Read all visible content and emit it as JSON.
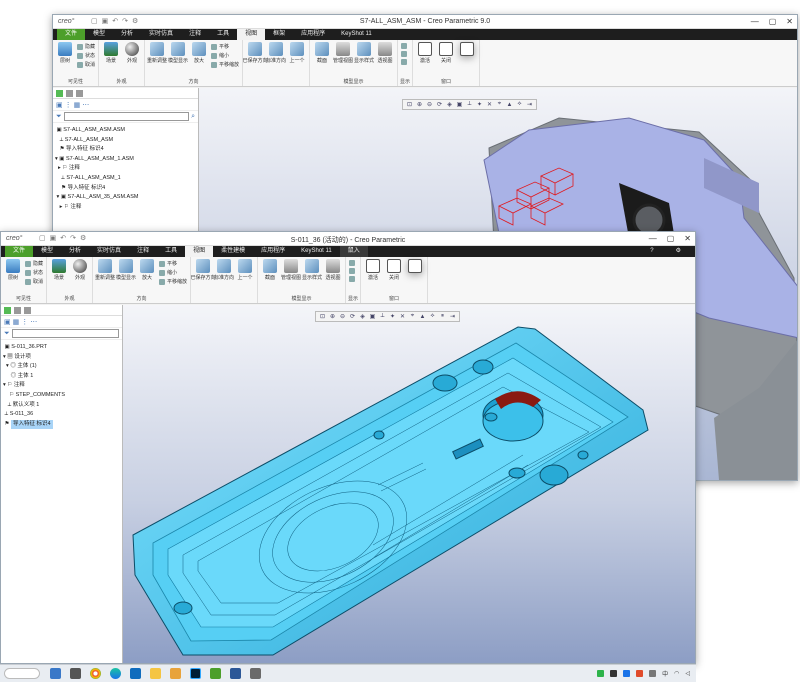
{
  "back_window": {
    "logo": "creo°",
    "title": "S7-ALL_ASM_ASM - Creo Parametric 9.0",
    "menu": [
      "文件",
      "模型",
      "分析",
      "实时仿真",
      "注释",
      "工具",
      "视图",
      "框架",
      "应用程序",
      "KeyShot 11"
    ],
    "active_menu": "视图",
    "ribbon_groups": [
      {
        "label": "可见性",
        "big": [
          {
            "label": "层树",
            "icon": "layer-icon"
          }
        ],
        "small": [
          "隐藏",
          "状态",
          "取消"
        ]
      },
      {
        "label": "外观",
        "big": [
          {
            "label": "场景",
            "icon": "scene-icon"
          },
          {
            "label": "外观",
            "icon": "appearance-icon"
          }
        ],
        "small": []
      },
      {
        "label": "方向",
        "big": [
          {
            "label": "重新调整",
            "icon": "refit-icon"
          },
          {
            "label": "模型显示",
            "icon": "model-display-icon"
          },
          {
            "label": "放大",
            "icon": "zoom-in-icon"
          }
        ],
        "small": [
          "平移",
          "缩小",
          "平移缩放"
        ]
      },
      {
        "label": "",
        "big": [
          {
            "label": "已保存方向",
            "icon": "saved-orientation-icon"
          },
          {
            "label": "标准方向",
            "icon": "standard-orientation-icon"
          },
          {
            "label": "上一个",
            "icon": "previous-icon"
          }
        ],
        "small": []
      },
      {
        "label": "模型显示",
        "big": [
          {
            "label": "截面",
            "icon": "section-icon"
          },
          {
            "label": "管理视图",
            "icon": "manage-views-icon"
          },
          {
            "label": "显示样式",
            "icon": "display-style-icon"
          },
          {
            "label": "透视图",
            "icon": "perspective-icon"
          }
        ],
        "small": []
      },
      {
        "label": "显示",
        "big": [],
        "small": [
          "",
          "",
          ""
        ]
      },
      {
        "label": "窗口",
        "big": [
          {
            "label": "激活",
            "icon": "activate-icon"
          },
          {
            "label": "关闭",
            "icon": "close-window-icon"
          },
          {
            "label": "窗口",
            "icon": "windows-icon"
          }
        ],
        "small": []
      }
    ],
    "tree": [
      "S7-ALL_ASM_ASM.ASM",
      "S7-ALL_ASM_ASM",
      "导入特征 标识4",
      "S7-ALL_ASM_ASM_1.ASM",
      "注释",
      "S7-ALL_ASM_ASM_1",
      "导入特征 标识4",
      "S7-ALL_ASM_35_ASM.ASM",
      "注释"
    ]
  },
  "front_window": {
    "logo": "creo°",
    "title": "S-011_36 (活动的) - Creo Parametric",
    "menu": [
      "文件",
      "模型",
      "分析",
      "实时仿真",
      "注释",
      "工具",
      "视图",
      "柔性建模",
      "应用程序",
      "KeyShot 11",
      "鼠入"
    ],
    "active_menu": "视图",
    "ribbon_groups": [
      {
        "label": "可见性",
        "big": [
          {
            "label": "层树",
            "icon": "layer-icon"
          }
        ],
        "small": [
          "隐藏",
          "状态",
          "取消"
        ]
      },
      {
        "label": "外观",
        "big": [
          {
            "label": "场景",
            "icon": "scene-icon"
          },
          {
            "label": "外观",
            "icon": "appearance-icon"
          }
        ],
        "small": []
      },
      {
        "label": "方向",
        "big": [
          {
            "label": "重新调整",
            "icon": "refit-icon"
          },
          {
            "label": "模型显示",
            "icon": "model-display-icon"
          },
          {
            "label": "放大",
            "icon": "zoom-in-icon"
          }
        ],
        "small": [
          "平移",
          "缩小",
          "平移缩放"
        ]
      },
      {
        "label": "",
        "big": [
          {
            "label": "已保存方向",
            "icon": "saved-orientation-icon"
          },
          {
            "label": "标准方向",
            "icon": "standard-orientation-icon"
          },
          {
            "label": "上一个",
            "icon": "previous-icon"
          }
        ],
        "small": []
      },
      {
        "label": "模型显示",
        "big": [
          {
            "label": "截面",
            "icon": "section-icon"
          },
          {
            "label": "管理视图",
            "icon": "manage-views-icon"
          },
          {
            "label": "显示样式",
            "icon": "display-style-icon"
          },
          {
            "label": "透视图",
            "icon": "perspective-icon"
          }
        ],
        "small": []
      },
      {
        "label": "显示",
        "big": [],
        "small": [
          "",
          "",
          ""
        ]
      },
      {
        "label": "窗口",
        "big": [
          {
            "label": "激活",
            "icon": "activate-icon"
          },
          {
            "label": "关闭",
            "icon": "close-window-icon"
          },
          {
            "label": "窗口",
            "icon": "windows-icon"
          }
        ],
        "small": []
      }
    ],
    "tree": [
      "S-011_36.PRT",
      "设计项",
      "主体 (1)",
      "主体 1",
      "注释",
      "STEP_COMMENTS",
      "默认义项 1",
      "S-011_36",
      "导入特征 标识4"
    ],
    "selected_tree_item": "导入特征 标识4"
  },
  "colors": {
    "creo_green": "#4c9f2a",
    "model_cyan": "#41c8ee",
    "model_lavender": "#a9b2e6",
    "selection_red": "#e0191e"
  },
  "taskbar": {
    "tray_text": "中",
    "icons": [
      "windows-icon",
      "search-icon",
      "task-view-icon",
      "chrome-icon",
      "edge-icon",
      "store-icon",
      "folder-icon",
      "files-icon",
      "photoshop-icon",
      "creo-icon",
      "app-icon",
      "app-icon"
    ]
  }
}
